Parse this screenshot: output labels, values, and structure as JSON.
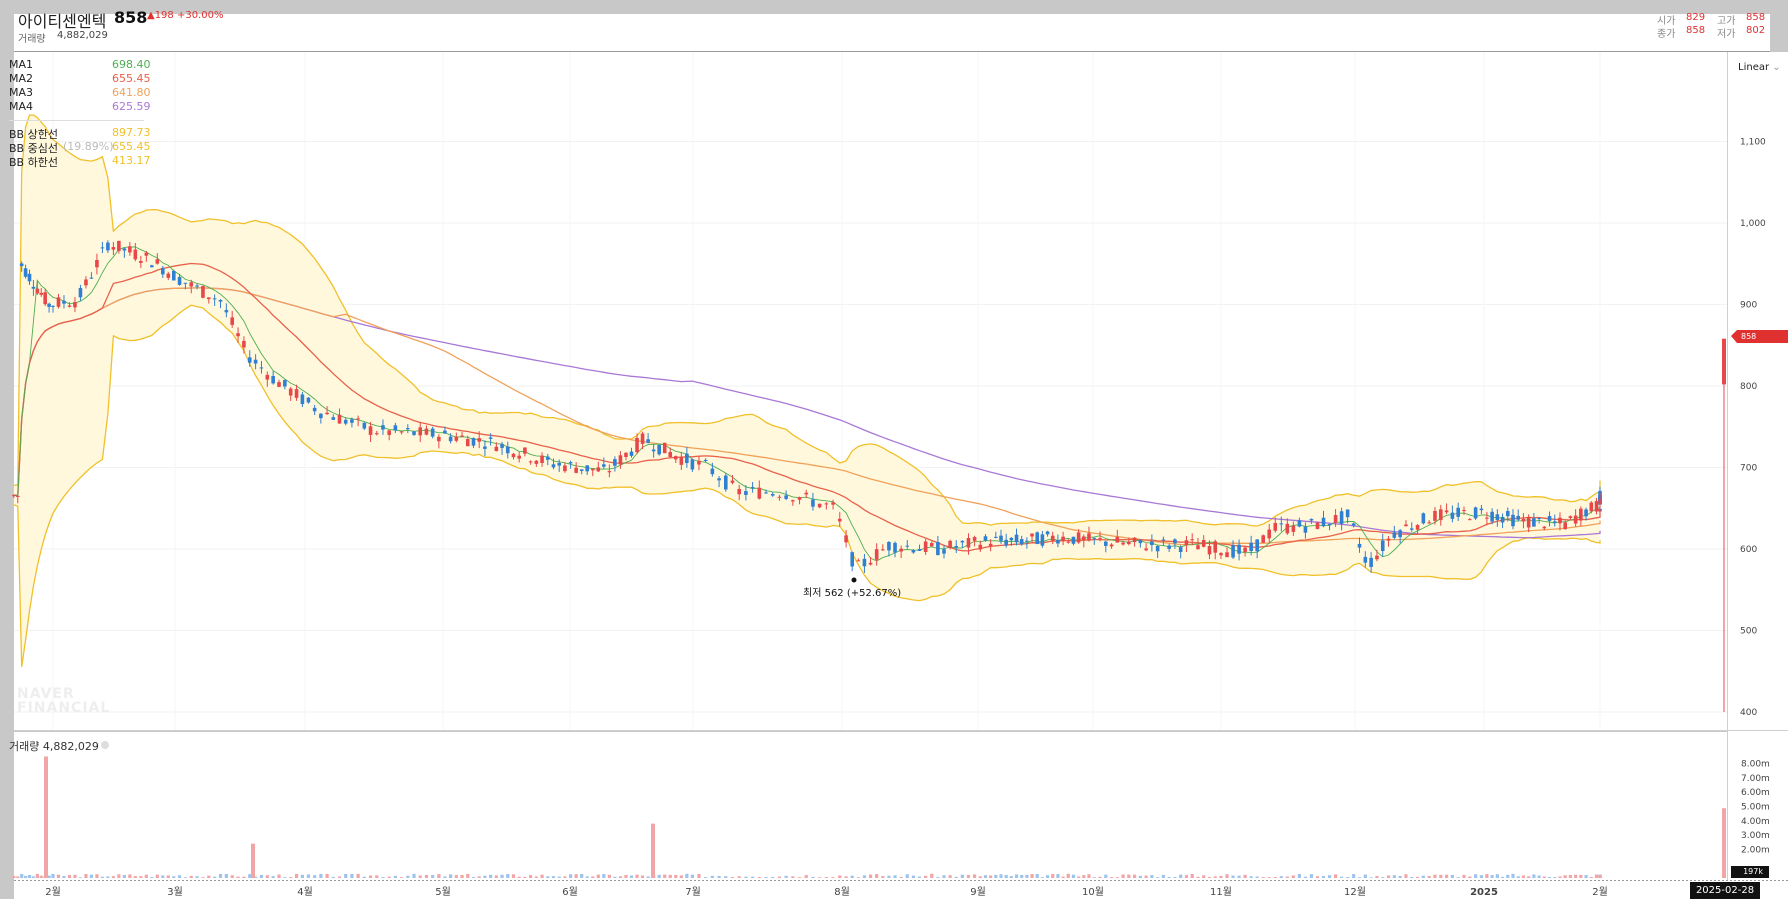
{
  "header": {
    "name": "아이티센엔텍",
    "price": "858",
    "change": "▲198 +30.00%",
    "volume_label": "거래량",
    "volume_value": "4,882,029",
    "ohlc": [
      {
        "k": "시가",
        "v": "829"
      },
      {
        "k": "고가",
        "v": "858"
      },
      {
        "k": "종가",
        "v": "858"
      },
      {
        "k": "저가",
        "v": "802"
      }
    ]
  },
  "legend": [
    {
      "name": "MA1",
      "value": "698.40",
      "color": "#4caf50"
    },
    {
      "name": "MA2",
      "value": "655.45",
      "color": "#e8614b"
    },
    {
      "name": "MA3",
      "value": "641.80",
      "color": "#f0a15a"
    },
    {
      "name": "MA4",
      "value": "625.59",
      "color": "#a978d6"
    },
    {
      "name": "BB 상한선",
      "value": "897.73",
      "color": "#f0c02a"
    },
    {
      "name": "BB 중심선",
      "pct": "(19.89%)",
      "value": "655.45",
      "color": "#f0c02a"
    },
    {
      "name": "BB 하한선",
      "value": "413.17",
      "color": "#f0c02a"
    }
  ],
  "watermark": [
    "NAVER",
    "FINANCIAL"
  ],
  "scale_button": "Linear",
  "current_price_tag": "858",
  "volume_pane": {
    "caption_label": "거래량",
    "caption_value": "4,882,029",
    "current_tag": "197k"
  },
  "date_tag": "2025-02-28",
  "colors": {
    "up": "#e8474a",
    "down": "#2f7fd3",
    "upper_band": "#f0c02a",
    "band_fill": "#fff8dc"
  },
  "chart_data": {
    "type": "candlestick",
    "price_axis": {
      "ticks": [
        400,
        500,
        600,
        700,
        800,
        900,
        1000,
        1100
      ],
      "tick_labels": [
        "400",
        "500",
        "600",
        "700",
        "800",
        "900",
        "1,000",
        "1,100"
      ]
    },
    "volume_axis": {
      "ticks": [
        2,
        3,
        4,
        5,
        6,
        7,
        8
      ],
      "tick_labels": [
        "2.00m",
        "3.00m",
        "4.00m",
        "5.00m",
        "6.00m",
        "7.00m",
        "8.00m"
      ]
    },
    "x_labels": [
      "2월",
      "3월",
      "4월",
      "5월",
      "6월",
      "7월",
      "8월",
      "9월",
      "10월",
      "11월",
      "12월",
      "2025",
      "2월"
    ],
    "annotation": {
      "text": "최저 562 (+52.67%)",
      "value": 562,
      "month": "8월"
    },
    "key_points": [
      {
        "month": "1월 말",
        "price": 955
      },
      {
        "month": "2월 중",
        "price": 975
      },
      {
        "month": "3월 말",
        "price": 840
      },
      {
        "month": "4월",
        "price": 770
      },
      {
        "month": "5월",
        "price": 740
      },
      {
        "month": "6월",
        "price": 700
      },
      {
        "month": "6월 말",
        "price": 735
      },
      {
        "month": "7월",
        "price": 680
      },
      {
        "month": "8월 초",
        "price": 575
      },
      {
        "month": "9월",
        "price": 605
      },
      {
        "month": "10월",
        "price": 615
      },
      {
        "month": "11월",
        "price": 600
      },
      {
        "month": "12월",
        "price": 630
      },
      {
        "month": "2025",
        "price": 640
      },
      {
        "month": "2월",
        "price": 655
      },
      {
        "month": "2025-02-28",
        "price": 858
      }
    ],
    "volume_spikes_m": [
      {
        "month": "2월",
        "value": 8.5
      },
      {
        "month": "3월 말",
        "value": 2.4
      },
      {
        "month": "7월",
        "value": 3.8
      },
      {
        "month": "2025-02-28",
        "value": 4.88
      }
    ]
  }
}
